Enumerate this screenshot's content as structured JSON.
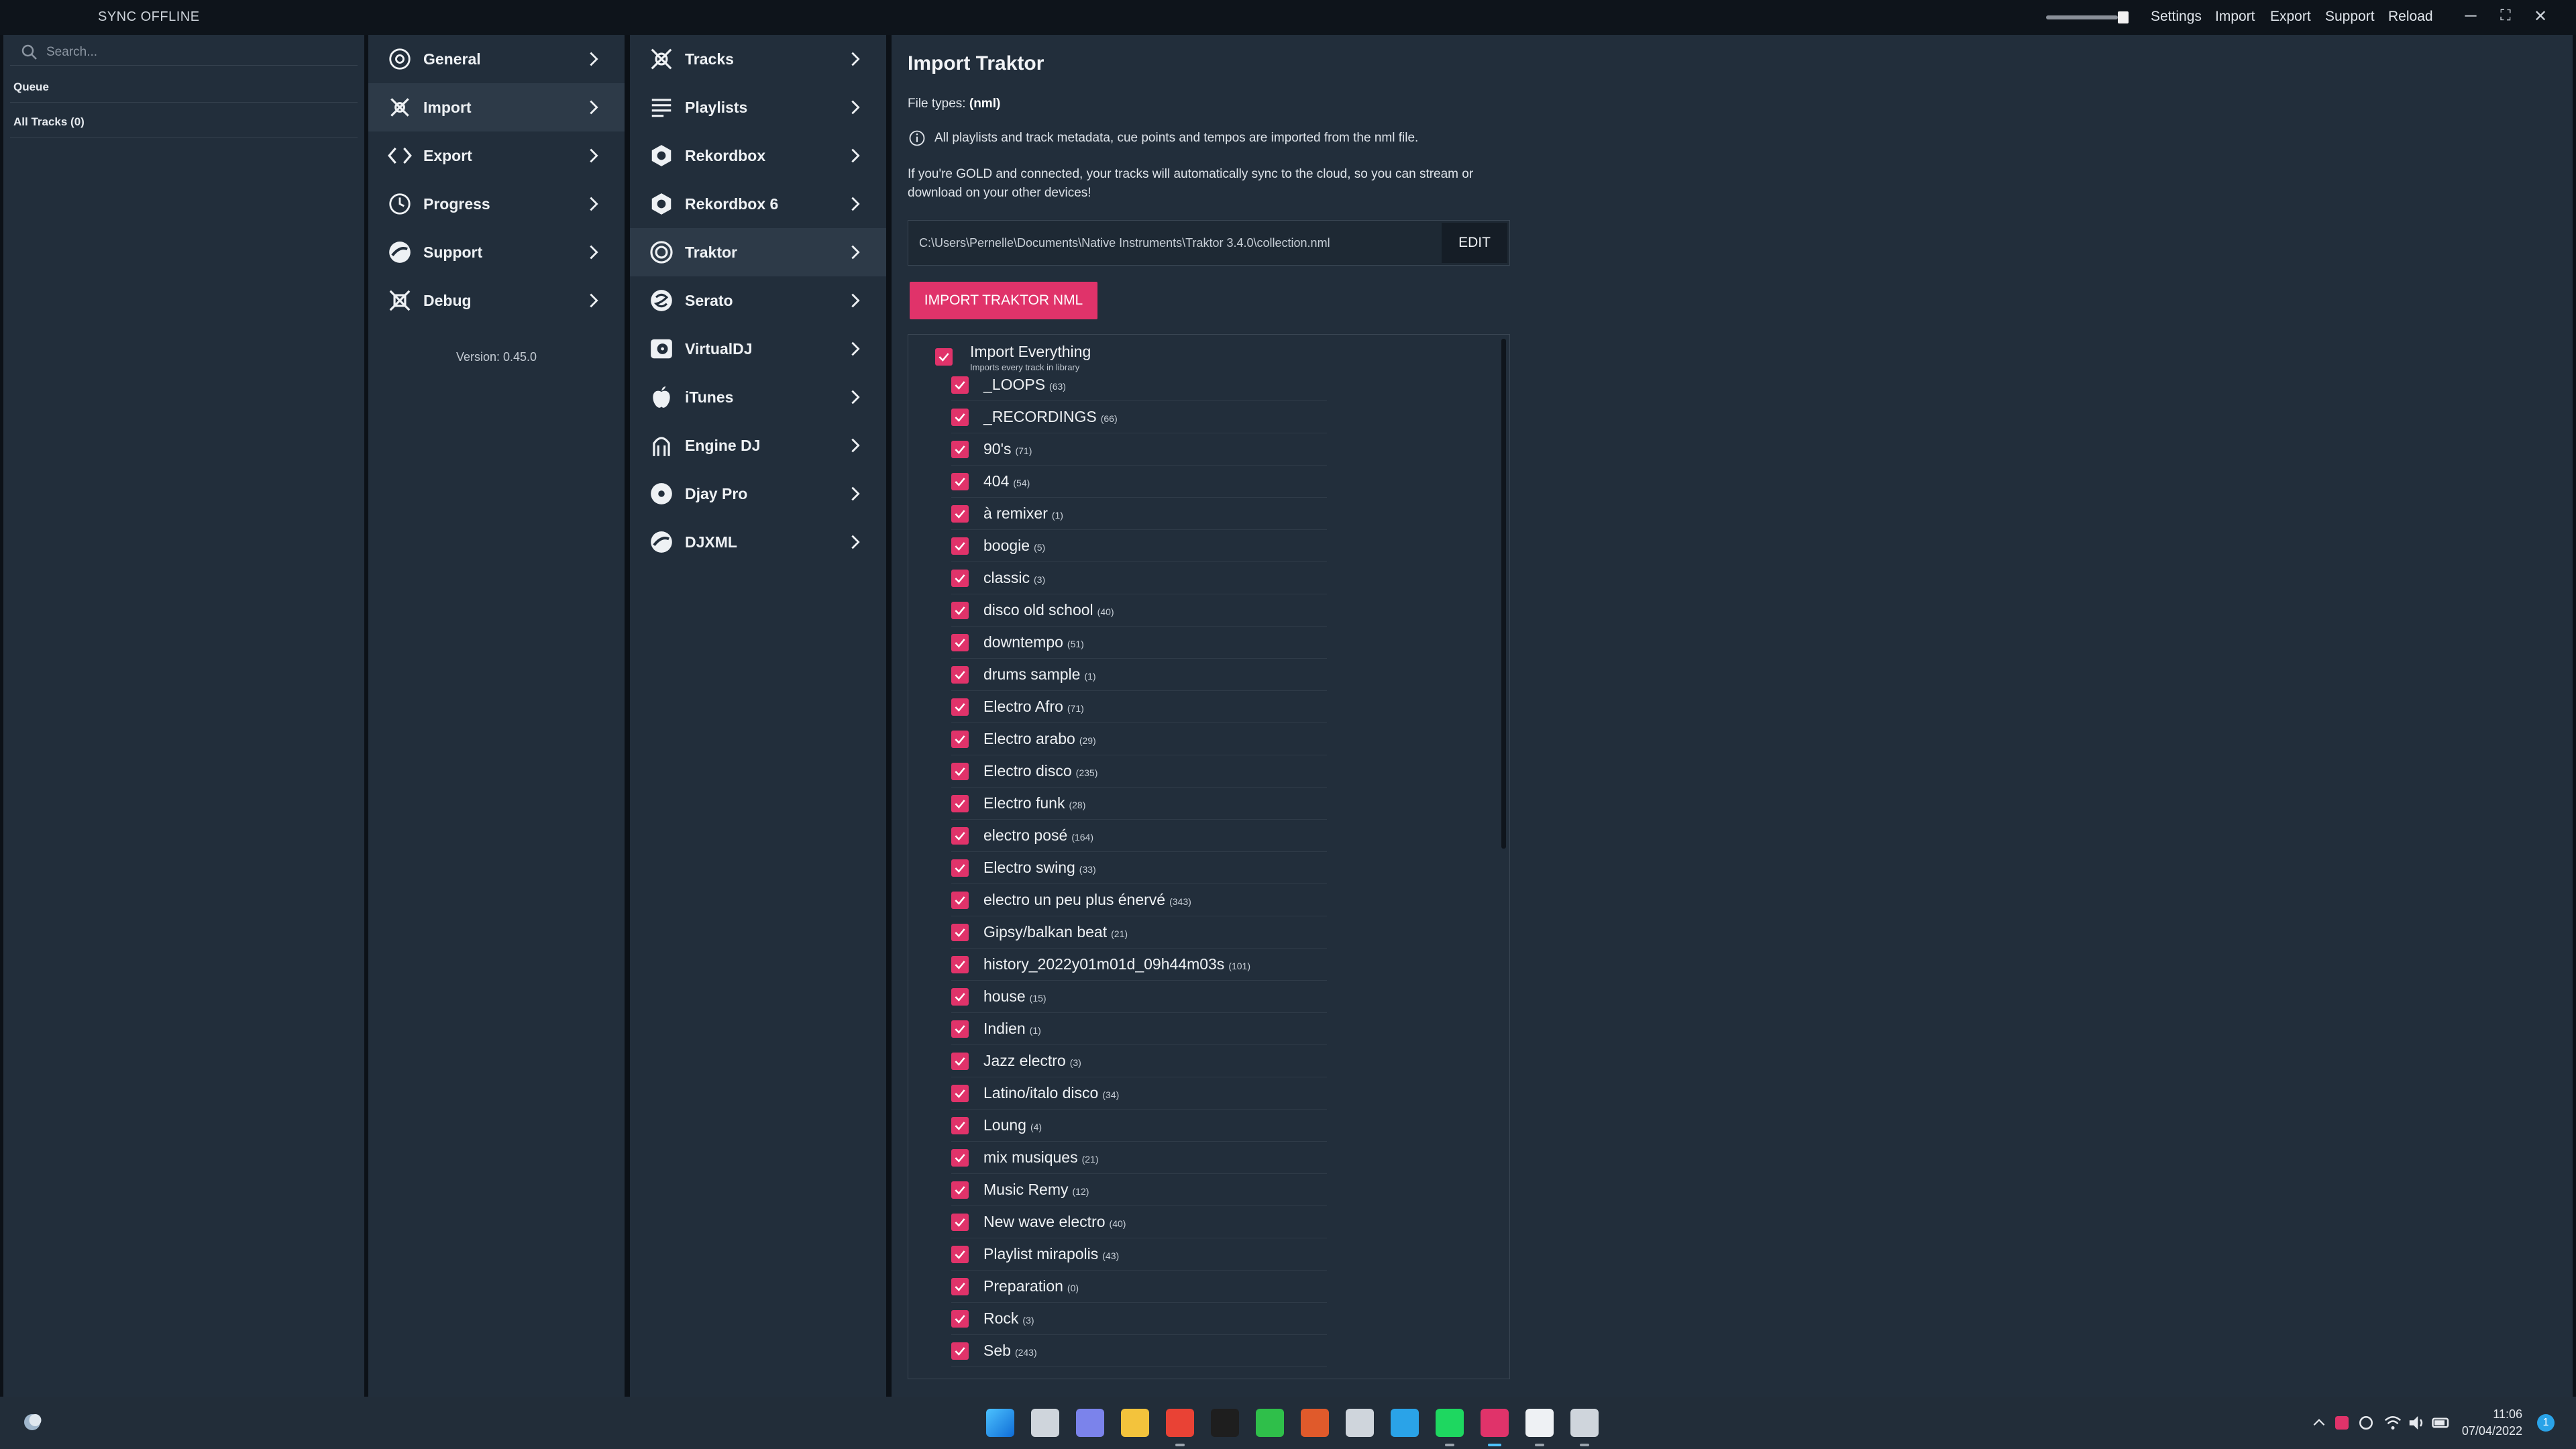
{
  "titlebar": {
    "sync_status": "SYNC OFFLINE",
    "volume_level": 0.85,
    "menu": [
      "Settings",
      "Import",
      "Export",
      "Support",
      "Reload"
    ]
  },
  "left_panel": {
    "search_placeholder": "Search...",
    "queue_label": "Queue",
    "all_tracks_label": "All Tracks (0)"
  },
  "nav_primary": {
    "items": [
      {
        "label": "General",
        "icon": "gear-icon"
      },
      {
        "label": "Import",
        "icon": "import-icon"
      },
      {
        "label": "Export",
        "icon": "code-icon"
      },
      {
        "label": "Progress",
        "icon": "clock-icon"
      },
      {
        "label": "Support",
        "icon": "support-icon"
      },
      {
        "label": "Debug",
        "icon": "debug-icon"
      }
    ],
    "active": "Import",
    "version": "Version: 0.45.0"
  },
  "nav_sources": {
    "items": [
      {
        "label": "Tracks",
        "icon": "tracks-icon"
      },
      {
        "label": "Playlists",
        "icon": "playlist-icon"
      },
      {
        "label": "Rekordbox",
        "icon": "rekordbox-icon"
      },
      {
        "label": "Rekordbox 6",
        "icon": "rekordbox6-icon"
      },
      {
        "label": "Traktor",
        "icon": "traktor-icon"
      },
      {
        "label": "Serato",
        "icon": "serato-icon"
      },
      {
        "label": "VirtualDJ",
        "icon": "virtualdj-icon"
      },
      {
        "label": "iTunes",
        "icon": "apple-icon"
      },
      {
        "label": "Engine DJ",
        "icon": "engine-icon"
      },
      {
        "label": "Djay Pro",
        "icon": "djay-icon"
      },
      {
        "label": "DJXML",
        "icon": "djxml-icon"
      }
    ],
    "active": "Traktor"
  },
  "main": {
    "title": "Import Traktor",
    "file_types_label": "File types:",
    "file_types_value": "(nml)",
    "info_text": "All playlists and track metadata, cue points and tempos are imported from the nml file.",
    "gold_text": "If you're GOLD and connected, your tracks will automatically sync to the cloud, so you can stream or download on your other devices!",
    "path_value": "C:\\Users\\Pernelle\\Documents\\Native Instruments\\Traktor 3.4.0\\collection.nml",
    "edit_label": "EDIT",
    "import_button": "IMPORT TRAKTOR NML",
    "import_everything_label": "Import Everything",
    "import_everything_sub": "Imports every track in library",
    "accent_color": "#e0336a",
    "playlists": [
      {
        "name": "_LOOPS",
        "count": "(63)"
      },
      {
        "name": "_RECORDINGS",
        "count": "(66)"
      },
      {
        "name": "90's",
        "count": "(71)"
      },
      {
        "name": "404",
        "count": "(54)"
      },
      {
        "name": "à remixer",
        "count": "(1)"
      },
      {
        "name": "boogie",
        "count": "(5)"
      },
      {
        "name": "classic",
        "count": "(3)"
      },
      {
        "name": "disco old school",
        "count": "(40)"
      },
      {
        "name": "downtempo",
        "count": "(51)"
      },
      {
        "name": "drums sample",
        "count": "(1)"
      },
      {
        "name": "Electro Afro",
        "count": "(71)"
      },
      {
        "name": "Electro arabo",
        "count": "(29)"
      },
      {
        "name": "Electro disco",
        "count": "(235)"
      },
      {
        "name": "Electro funk",
        "count": "(28)"
      },
      {
        "name": "electro posé",
        "count": "(164)"
      },
      {
        "name": "Electro swing",
        "count": "(33)"
      },
      {
        "name": "electro un peu plus énervé",
        "count": "(343)"
      },
      {
        "name": "Gipsy/balkan beat",
        "count": "(21)"
      },
      {
        "name": "history_2022y01m01d_09h44m03s",
        "count": "(101)"
      },
      {
        "name": "house",
        "count": "(15)"
      },
      {
        "name": "Indien",
        "count": "(1)"
      },
      {
        "name": "Jazz electro",
        "count": "(3)"
      },
      {
        "name": "Latino/italo disco",
        "count": "(34)"
      },
      {
        "name": "Loung",
        "count": "(4)"
      },
      {
        "name": "mix musiques",
        "count": "(21)"
      },
      {
        "name": "Music Remy",
        "count": "(12)"
      },
      {
        "name": "New wave electro",
        "count": "(40)"
      },
      {
        "name": "Playlist mirapolis",
        "count": "(43)"
      },
      {
        "name": "Preparation",
        "count": "(0)"
      },
      {
        "name": "Rock",
        "count": "(3)"
      },
      {
        "name": "Seb",
        "count": "(243)"
      }
    ]
  },
  "taskbar": {
    "apps": [
      "windows-start-icon",
      "task-view-icon",
      "teams-chat-icon",
      "file-explorer-icon",
      "chrome-icon",
      "ableton-live-icon",
      "green-app-icon",
      "gift-app-icon",
      "paint-icon",
      "edge-icon",
      "spotify-icon",
      "rekordcloud-icon",
      "traktor-taskbar-icon",
      "serato-taskbar-icon"
    ],
    "time": "11:06",
    "date": "07/04/2022",
    "notifications": "1"
  }
}
